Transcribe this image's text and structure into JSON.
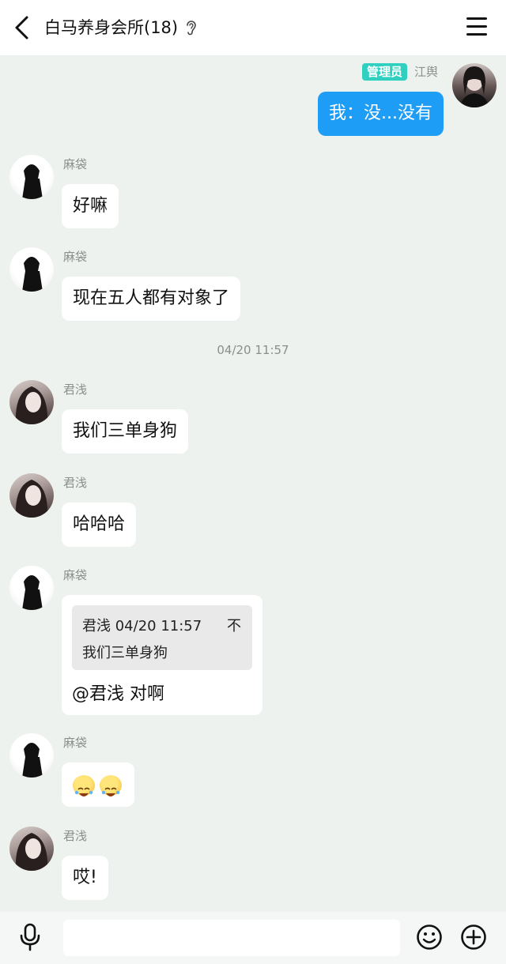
{
  "header": {
    "title": "白马养身会所(18)",
    "icons": {
      "back": "chevron-left-icon",
      "ear": "ear-icon",
      "menu": "menu-icon"
    }
  },
  "messages": [
    {
      "sender": "江舆",
      "badge": "管理员",
      "text": "我：没...没有",
      "self": true
    },
    {
      "sender": "麻袋",
      "text": "好嘛"
    },
    {
      "sender": "麻袋",
      "text": "现在五人都有对象了"
    },
    {
      "timestamp": "04/20 11:57"
    },
    {
      "sender": "君浅",
      "text": "我们三单身狗"
    },
    {
      "sender": "君浅",
      "text": "哈哈哈"
    },
    {
      "sender": "麻袋",
      "quote": {
        "header": "君浅 04/20 11:57",
        "arrow": "不",
        "text": "我们三单身狗"
      },
      "text": "@君浅 对啊"
    },
    {
      "sender": "麻袋",
      "emoji": [
        "face-with-tears-of-joy-icon",
        "face-with-tears-of-joy-icon"
      ]
    },
    {
      "sender": "君浅",
      "text": "哎!"
    }
  ],
  "input_bar": {
    "placeholder": "",
    "icons": {
      "mic": "microphone-icon",
      "emoji": "smiley-icon",
      "plus": "plus-circle-icon"
    }
  },
  "colors": {
    "background": "#edf2ef",
    "self_bubble": "#1e9df7",
    "admin_badge": "#2fd0c0",
    "sender_gray": "#8a8f8c"
  }
}
